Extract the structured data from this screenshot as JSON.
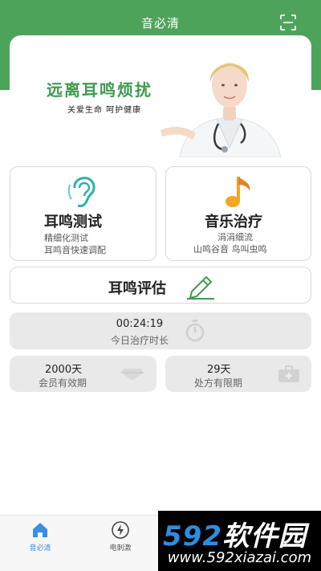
{
  "header": {
    "title": "音必清",
    "scan_icon": "scan-icon"
  },
  "banner": {
    "title": "远离耳鸣烦扰",
    "subtitle": "关爱生命  呵护健康"
  },
  "cards": {
    "test": {
      "title": "耳鸣测试",
      "line1": "精细化测试",
      "line2": "耳鸣音快速调配",
      "icon": "ear-icon"
    },
    "music": {
      "title": "音乐治疗",
      "line1": "涓涓细流",
      "line2": "山鸣谷音 鸟叫虫鸣",
      "icon": "music-note-icon"
    },
    "eval": {
      "title": "耳鸣评估",
      "icon": "pen-icon"
    }
  },
  "stats": {
    "timer": {
      "value": "00:24:19",
      "label": "今日治疗时长",
      "icon": "stopwatch-icon"
    },
    "member": {
      "value": "2000天",
      "label": "会员有效期",
      "icon": "diamond-icon"
    },
    "prescription": {
      "value": "29天",
      "label": "处方有限期",
      "icon": "medical-kit-icon"
    }
  },
  "tabbar": {
    "home": {
      "label": "音必清",
      "icon": "home-icon"
    },
    "estim": {
      "label": "电刺激",
      "icon": "lightning-icon"
    }
  },
  "watermark": {
    "brand_num": "592",
    "brand_text": "软件园",
    "url": "www.592xiazai.com"
  },
  "colors": {
    "primary_green": "#4ea35a",
    "tab_active": "#3a8ee6",
    "card_gray": "#e9e9e9",
    "note_orange": "#f5a623"
  }
}
